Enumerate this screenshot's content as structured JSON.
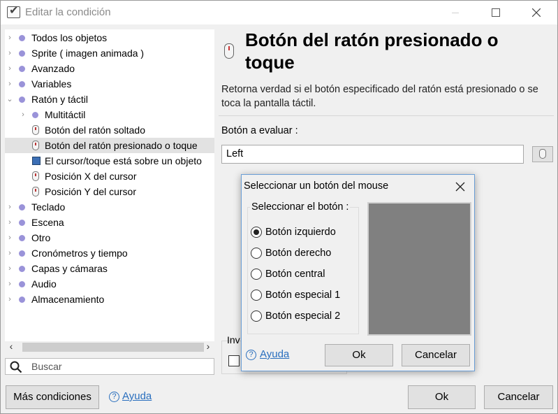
{
  "window": {
    "title": "Editar la condición"
  },
  "tree": {
    "items": [
      {
        "label": "Todos los objetos",
        "type": "category"
      },
      {
        "label": "Sprite ( imagen animada )",
        "type": "category"
      },
      {
        "label": "Avanzado",
        "type": "category"
      },
      {
        "label": "Variables",
        "type": "category"
      },
      {
        "label": "Ratón y táctil",
        "type": "category",
        "expanded": true
      },
      {
        "label": "Multitáctil",
        "type": "subcategory"
      },
      {
        "label": "Botón del ratón soltado",
        "type": "condition",
        "icon": "mouse-icon"
      },
      {
        "label": "Botón del ratón presionado o toque",
        "type": "condition",
        "icon": "mouse-icon",
        "selected": true
      },
      {
        "label": "El cursor/toque está sobre un objeto",
        "type": "condition",
        "icon": "cursor-icon"
      },
      {
        "label": "Posición X del cursor",
        "type": "condition",
        "icon": "mouse-icon"
      },
      {
        "label": "Posición Y del cursor",
        "type": "condition",
        "icon": "mouse-icon"
      },
      {
        "label": "Teclado",
        "type": "category"
      },
      {
        "label": "Escena",
        "type": "category"
      },
      {
        "label": "Otro",
        "type": "category"
      },
      {
        "label": "Cronómetros y tiempo",
        "type": "category"
      },
      {
        "label": "Capas y cámaras",
        "type": "category"
      },
      {
        "label": "Audio",
        "type": "category"
      },
      {
        "label": "Almacenamiento",
        "type": "category"
      }
    ]
  },
  "search": {
    "placeholder": "Buscar"
  },
  "detail": {
    "title": "Botón del ratón presionado o toque",
    "description": "Retorna verdad si el botón especificado del ratón está presionado o se toca la pantalla táctil.",
    "param_label": "Botón a evaluar :",
    "param_value": "Left",
    "invert_label": "Inv"
  },
  "footer": {
    "more_conditions": "Más condiciones",
    "help": "Ayuda",
    "ok": "Ok",
    "cancel": "Cancelar"
  },
  "modal": {
    "title": "Seleccionar un botón del mouse",
    "group_title": "Seleccionar el botón :",
    "options": [
      {
        "label": "Botón izquierdo",
        "selected": true
      },
      {
        "label": "Botón derecho",
        "selected": false
      },
      {
        "label": "Botón central",
        "selected": false
      },
      {
        "label": "Botón especial 1",
        "selected": false
      },
      {
        "label": "Botón especial 2",
        "selected": false
      }
    ],
    "help": "Ayuda",
    "ok": "Ok",
    "cancel": "Cancelar"
  }
}
